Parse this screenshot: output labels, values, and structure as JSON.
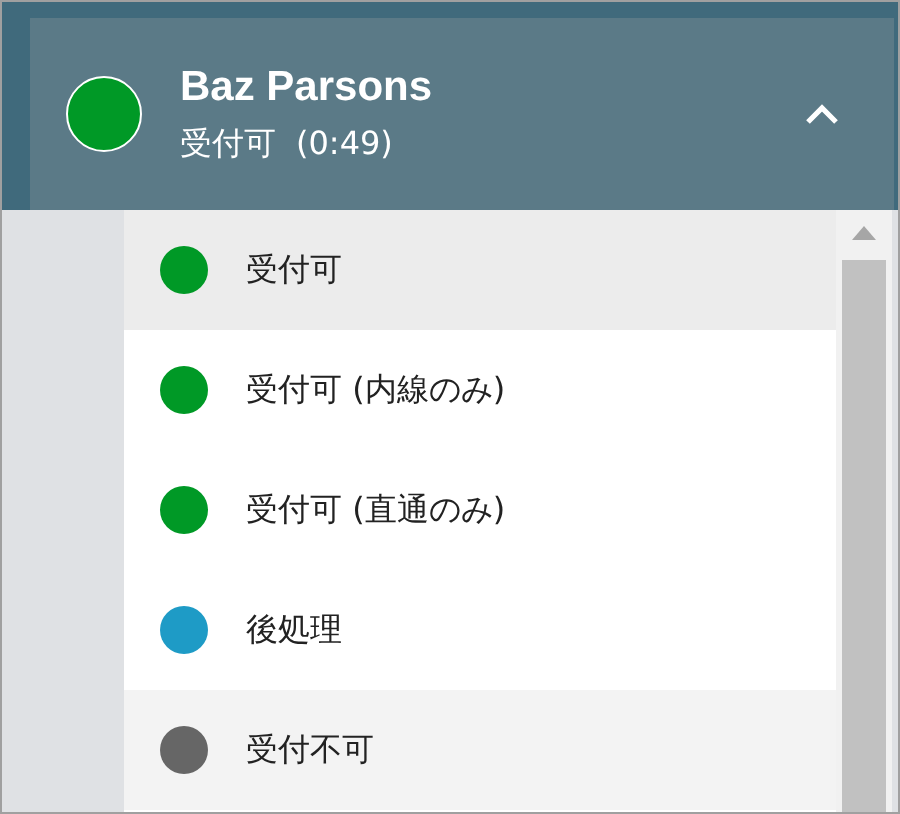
{
  "header": {
    "name": "Baz Parsons",
    "status": "受付可",
    "timer": "(0:49)",
    "expanded": true
  },
  "status_menu": {
    "items": [
      {
        "label": "受付可",
        "color": "#009926",
        "selected": true,
        "hovered": false
      },
      {
        "label": "受付可 (内線のみ)",
        "color": "#009926",
        "selected": false,
        "hovered": false
      },
      {
        "label": "受付可 (直通のみ)",
        "color": "#009926",
        "selected": false,
        "hovered": false
      },
      {
        "label": "後処理",
        "color": "#1e9bc6",
        "selected": false,
        "hovered": false
      },
      {
        "label": "受付不可",
        "color": "#666666",
        "selected": false,
        "hovered": true
      }
    ]
  }
}
